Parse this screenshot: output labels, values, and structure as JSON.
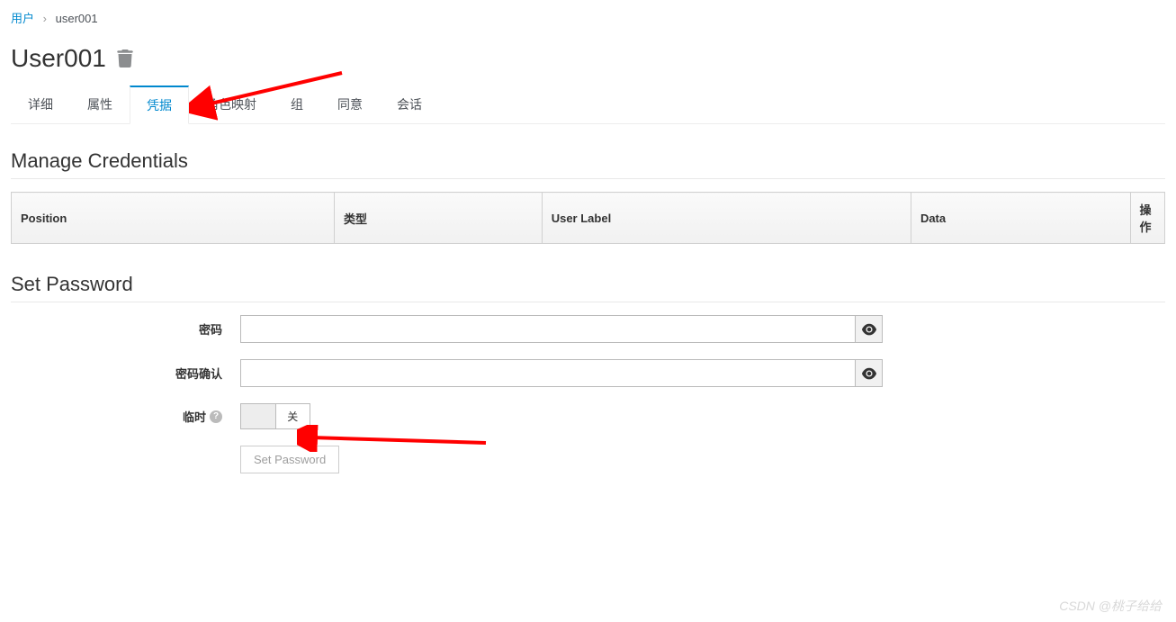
{
  "breadcrumb": {
    "root": "用户",
    "current": "user001"
  },
  "page_title": "User001",
  "tabs": [
    {
      "label": "详细",
      "active": false
    },
    {
      "label": "属性",
      "active": false
    },
    {
      "label": "凭据",
      "active": true
    },
    {
      "label": "角色映射",
      "active": false
    },
    {
      "label": "组",
      "active": false
    },
    {
      "label": "同意",
      "active": false
    },
    {
      "label": "会话",
      "active": false
    }
  ],
  "sections": {
    "manage_credentials": "Manage Credentials",
    "set_password": "Set Password"
  },
  "table_headers": {
    "position": "Position",
    "type": "类型",
    "user_label": "User Label",
    "data": "Data",
    "actions": "操作"
  },
  "form": {
    "password_label": "密码",
    "confirm_label": "密码确认",
    "temporary_label": "临时",
    "toggle_off": "关",
    "set_button": "Set Password"
  },
  "watermark": "CSDN @桃子给给"
}
